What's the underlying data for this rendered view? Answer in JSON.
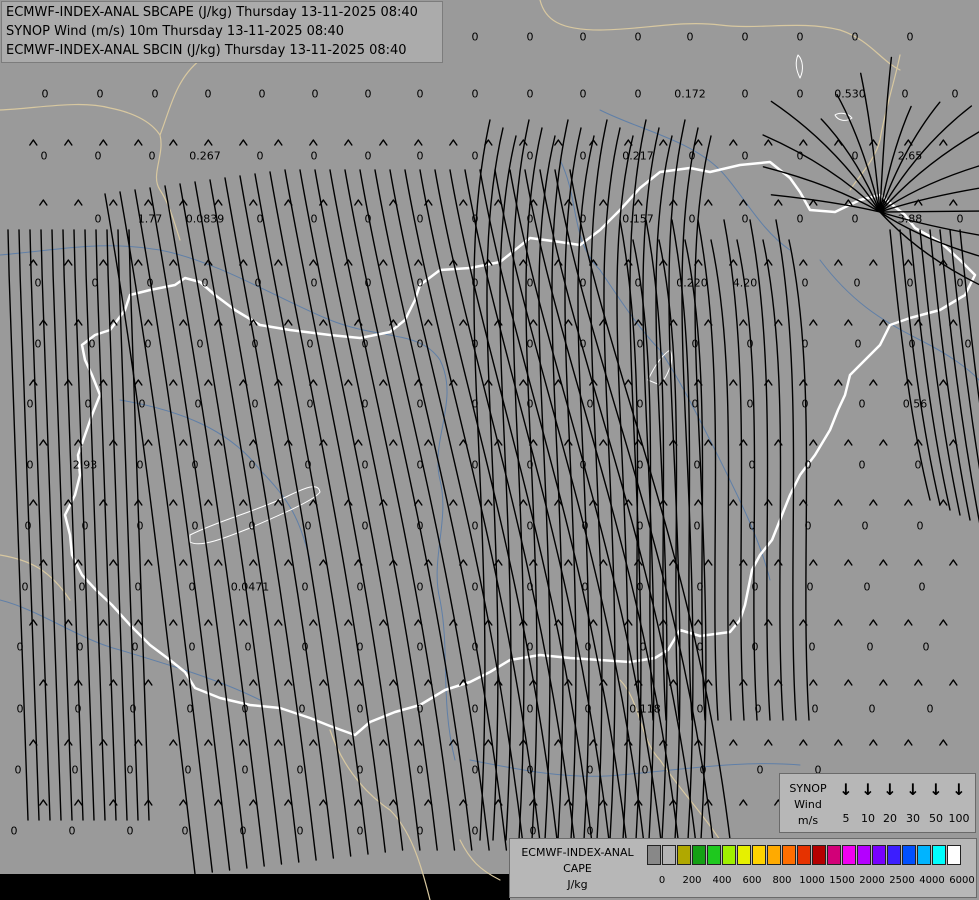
{
  "titles": [
    "ECMWF-INDEX-ANAL SBCAPE (J/kg) Thursday 13-11-2025 08:40",
    "SYNOP Wind (m/s) 10m Thursday 13-11-2025 08:40",
    "ECMWF-INDEX-ANAL SBCIN (J/kg) Thursday 13-11-2025 08:40"
  ],
  "colors": {
    "background": "#9a9a9a",
    "country_border": "#ffffff",
    "region_border": "#d8c8a0",
    "rivers": "#5f7fa8",
    "streamlines": "#000000"
  },
  "values": [
    {
      "t": "0"
    },
    {
      "t": "0"
    },
    {
      "t": "0"
    },
    {
      "t": "0"
    },
    {
      "t": "0"
    },
    {
      "t": "0"
    },
    {
      "t": "0"
    },
    {
      "t": "0"
    },
    {
      "t": "0"
    },
    {
      "t": "0"
    },
    {
      "t": "0"
    },
    {
      "t": "0"
    },
    {
      "t": "0"
    },
    {
      "t": "0"
    },
    {
      "t": "0"
    },
    {
      "t": "0"
    },
    {
      "t": "0"
    },
    {
      "t": "0"
    },
    {
      "t": "0"
    },
    {
      "t": "0"
    },
    {
      "t": "0"
    },
    {
      "t": "0.172"
    },
    {
      "t": "0"
    },
    {
      "t": "0"
    },
    {
      "t": "0.530"
    },
    {
      "t": "0"
    },
    {
      "t": "0"
    },
    {
      "t": "0"
    },
    {
      "t": "0"
    },
    {
      "t": "0"
    },
    {
      "t": "0.267"
    },
    {
      "t": "0"
    },
    {
      "t": "0"
    },
    {
      "t": "0"
    },
    {
      "t": "0"
    },
    {
      "t": "0"
    },
    {
      "t": "0"
    },
    {
      "t": "0"
    },
    {
      "t": "0.217"
    },
    {
      "t": "0"
    },
    {
      "t": "0"
    },
    {
      "t": "0"
    },
    {
      "t": "0"
    },
    {
      "t": "2.65"
    },
    {
      "t": "0"
    },
    {
      "t": "1.77"
    },
    {
      "t": "0.0839"
    },
    {
      "t": "0"
    },
    {
      "t": "0"
    },
    {
      "t": "0"
    },
    {
      "t": "0"
    },
    {
      "t": "0"
    },
    {
      "t": "0"
    },
    {
      "t": "0"
    },
    {
      "t": "0.157"
    },
    {
      "t": "0"
    },
    {
      "t": "0"
    },
    {
      "t": "0"
    },
    {
      "t": "0"
    },
    {
      "t": "3.88"
    },
    {
      "t": "0"
    },
    {
      "t": "0"
    },
    {
      "t": "0"
    },
    {
      "t": "0"
    },
    {
      "t": "0"
    },
    {
      "t": "0"
    },
    {
      "t": "0"
    },
    {
      "t": "0"
    },
    {
      "t": "0"
    },
    {
      "t": "0"
    },
    {
      "t": "0"
    },
    {
      "t": "0"
    },
    {
      "t": "0"
    },
    {
      "t": "0.220"
    },
    {
      "t": "4.20"
    },
    {
      "t": "0"
    },
    {
      "t": "0"
    },
    {
      "t": "0"
    },
    {
      "t": "0"
    },
    {
      "t": "0"
    },
    {
      "t": "0"
    },
    {
      "t": "0"
    },
    {
      "t": "0"
    },
    {
      "t": "0"
    },
    {
      "t": "0"
    },
    {
      "t": "0"
    },
    {
      "t": "0"
    },
    {
      "t": "0"
    },
    {
      "t": "0"
    },
    {
      "t": "0"
    },
    {
      "t": "0"
    },
    {
      "t": "0"
    },
    {
      "t": "0"
    },
    {
      "t": "0"
    },
    {
      "t": "0"
    },
    {
      "t": "0"
    },
    {
      "t": "0"
    },
    {
      "t": "0"
    },
    {
      "t": "0"
    },
    {
      "t": "0"
    },
    {
      "t": "0"
    },
    {
      "t": "0"
    },
    {
      "t": "0"
    },
    {
      "t": "0"
    },
    {
      "t": "0"
    },
    {
      "t": "0"
    },
    {
      "t": "0"
    },
    {
      "t": "0"
    },
    {
      "t": "0"
    },
    {
      "t": "0"
    },
    {
      "t": "0"
    },
    {
      "t": "0"
    },
    {
      "t": "0"
    },
    {
      "t": "0.56"
    },
    {
      "t": "0"
    },
    {
      "t": "2.93"
    },
    {
      "t": "0"
    },
    {
      "t": "0"
    },
    {
      "t": "0"
    },
    {
      "t": "0"
    },
    {
      "t": "0"
    },
    {
      "t": "0"
    },
    {
      "t": "0"
    },
    {
      "t": "0"
    },
    {
      "t": "0"
    },
    {
      "t": "0"
    },
    {
      "t": "0"
    },
    {
      "t": "0"
    },
    {
      "t": "0"
    },
    {
      "t": "0"
    },
    {
      "t": "0"
    },
    {
      "t": "0"
    },
    {
      "t": "0"
    },
    {
      "t": "0"
    },
    {
      "t": "0"
    },
    {
      "t": "0"
    },
    {
      "t": "0"
    },
    {
      "t": "0"
    },
    {
      "t": "0"
    },
    {
      "t": "0"
    },
    {
      "t": "0"
    },
    {
      "t": "0"
    },
    {
      "t": "0"
    },
    {
      "t": "0"
    },
    {
      "t": "0"
    },
    {
      "t": "0"
    },
    {
      "t": "0"
    },
    {
      "t": "0"
    },
    {
      "t": "0"
    },
    {
      "t": "0"
    },
    {
      "t": "0"
    },
    {
      "t": "0"
    },
    {
      "t": "0.0471"
    },
    {
      "t": "0"
    },
    {
      "t": "0"
    },
    {
      "t": "0"
    },
    {
      "t": "0"
    },
    {
      "t": "0"
    },
    {
      "t": "0"
    },
    {
      "t": "0"
    },
    {
      "t": "0"
    },
    {
      "t": "0"
    },
    {
      "t": "0"
    },
    {
      "t": "0"
    },
    {
      "t": "0"
    },
    {
      "t": "0"
    },
    {
      "t": "0"
    },
    {
      "t": "0"
    },
    {
      "t": "0"
    },
    {
      "t": "0"
    },
    {
      "t": "0"
    },
    {
      "t": "0"
    },
    {
      "t": "0"
    },
    {
      "t": "0"
    },
    {
      "t": "0"
    },
    {
      "t": "0"
    },
    {
      "t": "0"
    },
    {
      "t": "0"
    },
    {
      "t": "0"
    },
    {
      "t": "0"
    },
    {
      "t": "0"
    },
    {
      "t": "0"
    },
    {
      "t": "0"
    },
    {
      "t": "0"
    },
    {
      "t": "0"
    },
    {
      "t": "0"
    },
    {
      "t": "0"
    },
    {
      "t": "0"
    },
    {
      "t": "0"
    },
    {
      "t": "0"
    },
    {
      "t": "0"
    },
    {
      "t": "0"
    },
    {
      "t": "0"
    },
    {
      "t": "0.118"
    },
    {
      "t": "0"
    },
    {
      "t": "0"
    },
    {
      "t": "0"
    },
    {
      "t": "0"
    },
    {
      "t": "0"
    },
    {
      "t": "0"
    },
    {
      "t": "0"
    },
    {
      "t": "0"
    },
    {
      "t": "0"
    },
    {
      "t": "0"
    },
    {
      "t": "0"
    },
    {
      "t": "0"
    },
    {
      "t": "0"
    },
    {
      "t": "0"
    },
    {
      "t": "0"
    },
    {
      "t": "0"
    },
    {
      "t": "0"
    },
    {
      "t": "0"
    },
    {
      "t": "0"
    },
    {
      "t": "0"
    },
    {
      "t": "0"
    },
    {
      "t": "0"
    },
    {
      "t": "0"
    },
    {
      "t": "0"
    },
    {
      "t": "0"
    },
    {
      "t": "0"
    },
    {
      "t": "0"
    },
    {
      "t": "0"
    },
    {
      "t": "0"
    },
    {
      "t": "0"
    },
    {
      "t": "0"
    }
  ],
  "wind_legend": {
    "title_line1": "SYNOP",
    "title_line2": "Wind",
    "title_line3": "m/s",
    "labels": [
      "5",
      "10",
      "20",
      "30",
      "50",
      "100"
    ]
  },
  "cape_legend": {
    "title_line1": "ECMWF-INDEX-ANAL",
    "title_line2": "CAPE",
    "title_line3": "J/kg",
    "colors": [
      "#888888",
      "#b4b4b4",
      "#b0a800",
      "#14a014",
      "#1ec81e",
      "#a0f000",
      "#e6f000",
      "#ffd200",
      "#ffaa00",
      "#ff6e00",
      "#e63200",
      "#b40000",
      "#d20078",
      "#f000f0",
      "#b400ff",
      "#7800ff",
      "#3c1eff",
      "#0050ff",
      "#00b4ff",
      "#00ffff",
      "#ffffff"
    ],
    "labels": [
      "0",
      "200",
      "400",
      "600",
      "800",
      "1000",
      "1500",
      "2000",
      "2500",
      "4000",
      "6000"
    ]
  }
}
